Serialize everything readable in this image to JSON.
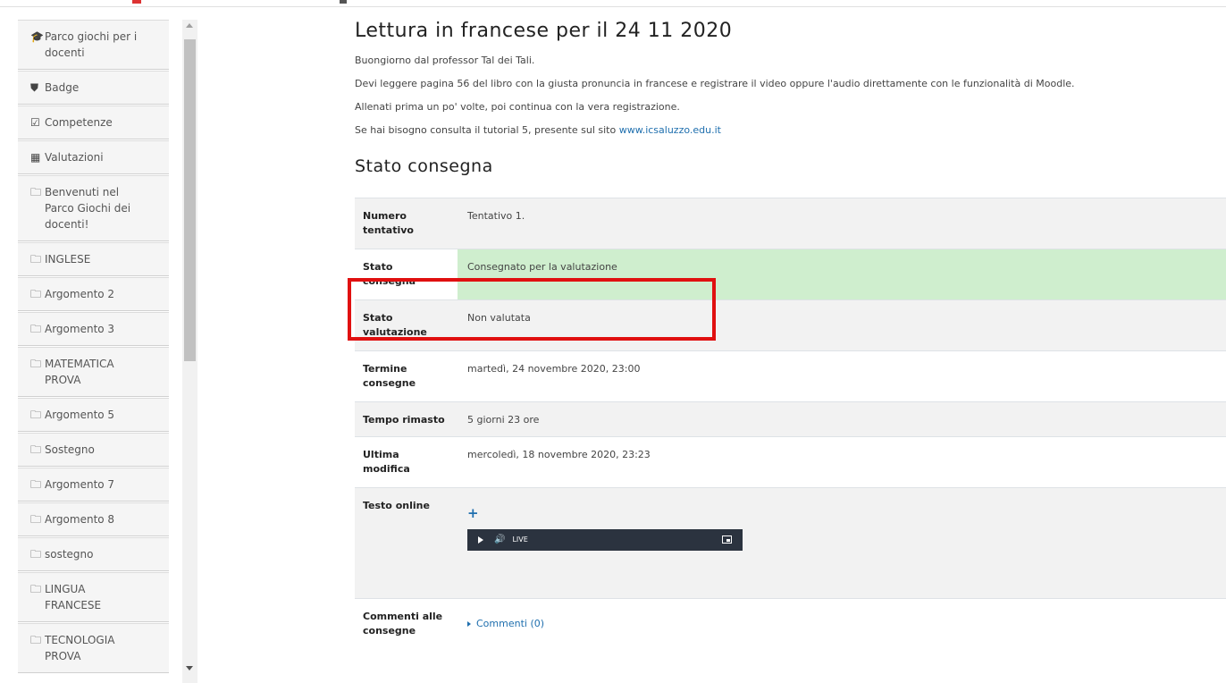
{
  "nav": {
    "items": [
      {
        "icon": "graduation-cap-icon",
        "glyph": "🎓",
        "label": "Parco giochi per i\ndocenti"
      },
      {
        "icon": "shield-icon",
        "glyph": "⛊",
        "label": "Badge"
      },
      {
        "icon": "checkbox-icon",
        "glyph": "☑",
        "label": "Competenze"
      },
      {
        "icon": "table-icon",
        "glyph": "▦",
        "label": "Valutazioni"
      },
      {
        "icon": "folder-icon",
        "glyph": "🗀",
        "label": "Benvenuti nel\nParco Giochi dei\ndocenti!"
      },
      {
        "icon": "folder-icon",
        "glyph": "🗀",
        "label": "INGLESE"
      },
      {
        "icon": "folder-icon",
        "glyph": "🗀",
        "label": "Argomento 2"
      },
      {
        "icon": "folder-icon",
        "glyph": "🗀",
        "label": "Argomento 3"
      },
      {
        "icon": "folder-icon",
        "glyph": "🗀",
        "label": "MATEMATICA\nPROVA"
      },
      {
        "icon": "folder-icon",
        "glyph": "🗀",
        "label": "Argomento 5"
      },
      {
        "icon": "folder-icon",
        "glyph": "🗀",
        "label": "Sostegno"
      },
      {
        "icon": "folder-icon",
        "glyph": "🗀",
        "label": "Argomento 7"
      },
      {
        "icon": "folder-icon",
        "glyph": "🗀",
        "label": "Argomento 8"
      },
      {
        "icon": "folder-icon",
        "glyph": "🗀",
        "label": "sostegno"
      },
      {
        "icon": "folder-icon",
        "glyph": "🗀",
        "label": "LINGUA\nFRANCESE"
      },
      {
        "icon": "folder-icon",
        "glyph": "🗀",
        "label": "TECNOLOGIA\nPROVA"
      }
    ]
  },
  "assignment": {
    "title": "Lettura in francese per il 24 11 2020",
    "intro": [
      "Buongiorno dal professor Tal dei Tali.",
      "Devi leggere pagina 56 del libro con la giusta pronuncia in francese e registrare il video oppure l'audio direttamente con le funzionalità di Moodle.",
      "Allenati prima un po' volte, poi continua con la vera registrazione."
    ],
    "help_prefix": "Se hai bisogno consulta il tutorial 5, presente sul sito ",
    "help_link": "www.icsaluzzo.edu.it"
  },
  "status": {
    "heading": "Stato consegna",
    "rows": {
      "attempt": {
        "label": "Numero\ntentativo",
        "value": "Tentativo 1."
      },
      "submission": {
        "label": "Stato\nconsegna",
        "value": "Consegnato per la valutazione"
      },
      "grading": {
        "label": "Stato\nvalutazione",
        "value": "Non valutata"
      },
      "due": {
        "label": "Termine\nconsegne",
        "value": "martedì, 24 novembre 2020, 23:00"
      },
      "remaining": {
        "label": "Tempo rimasto",
        "value": "5 giorni 23 ore"
      },
      "modified": {
        "label": "Ultima\nmodifica",
        "value": "mercoledì, 18 novembre 2020, 23:23"
      },
      "online_text": {
        "label": "Testo online",
        "plus": "+",
        "player_live": "LIVE"
      },
      "comments": {
        "label": "Commenti alle\nconsegne",
        "link": "Commenti (0)"
      }
    }
  },
  "colors": {
    "highlight": "#e01010",
    "submitted_bg": "#cfeece",
    "link": "#1f6fae",
    "player_bg": "#2b333f"
  }
}
